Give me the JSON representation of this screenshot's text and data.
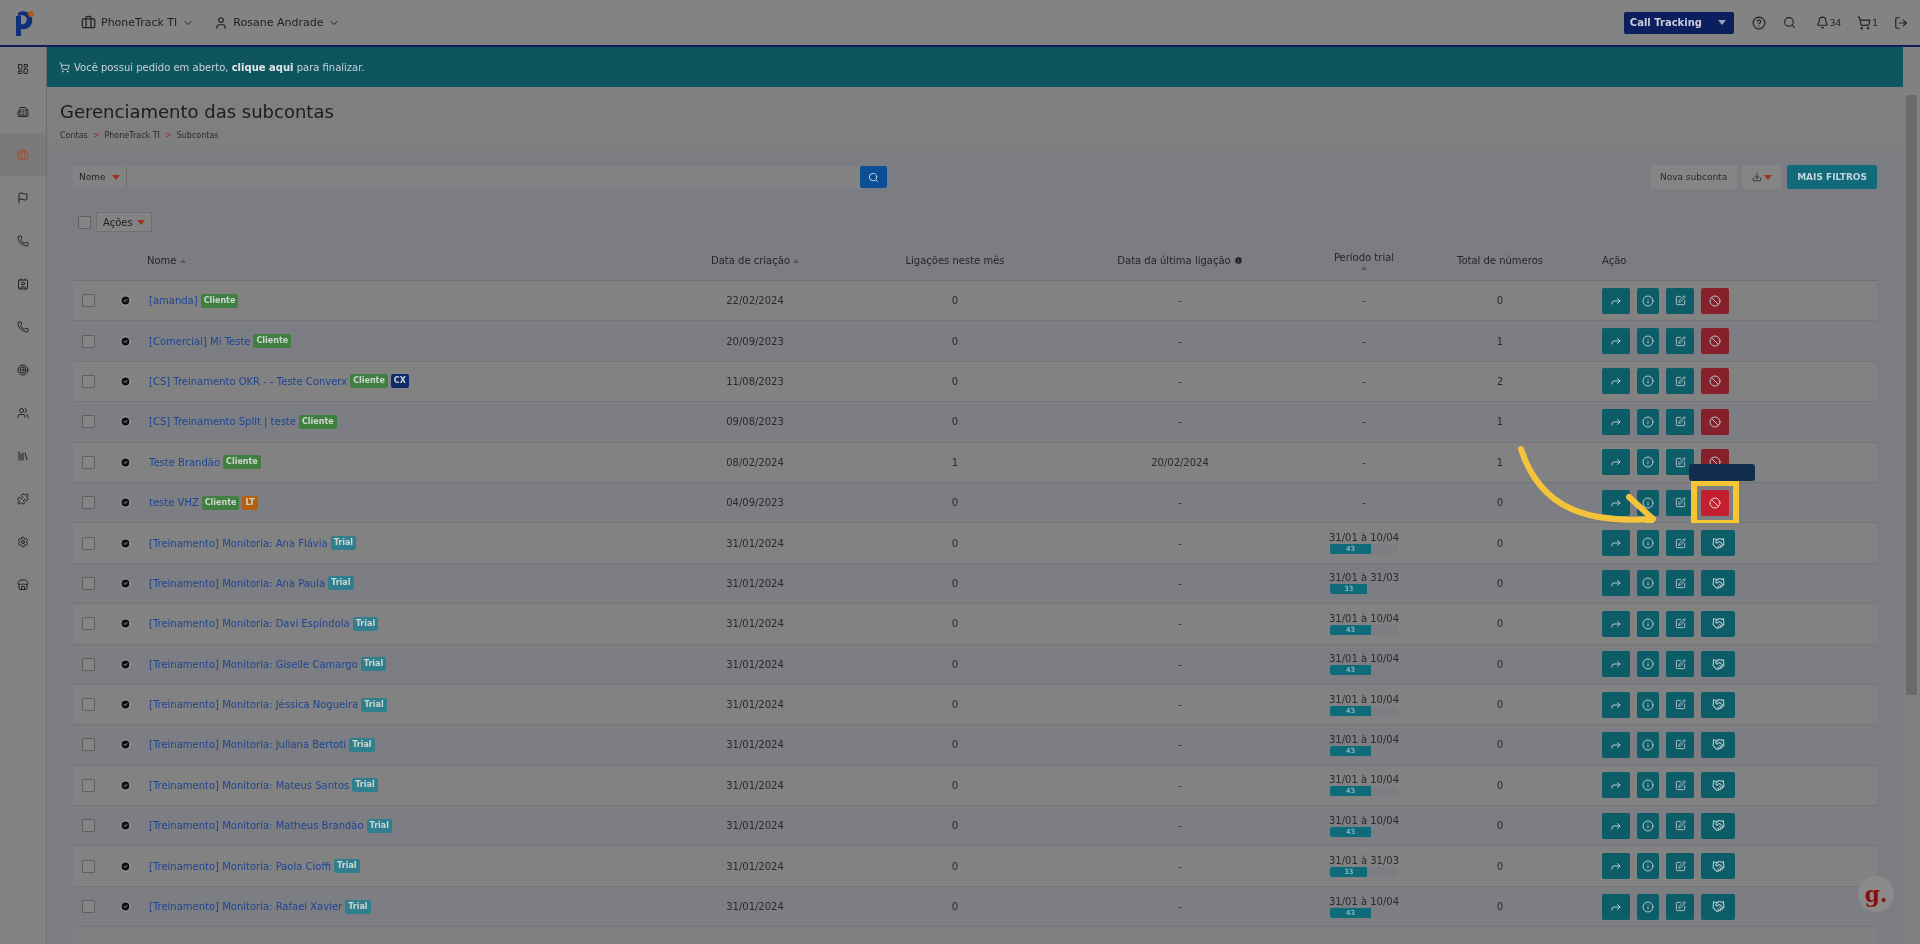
{
  "topbar": {
    "account": "PhoneTrack TI",
    "user": "Rosane Andrade",
    "product": "Call Tracking",
    "notifications": "34",
    "cart": "1"
  },
  "sidebar": {
    "items": [
      {
        "kind": "dashboard",
        "selected": false
      },
      {
        "kind": "building",
        "selected": false
      },
      {
        "kind": "briefcase",
        "selected": true
      },
      {
        "kind": "flag",
        "selected": false
      },
      {
        "kind": "phone",
        "selected": false
      },
      {
        "kind": "contact",
        "selected": false
      },
      {
        "kind": "phone",
        "selected": false
      },
      {
        "kind": "target",
        "selected": false
      },
      {
        "kind": "users",
        "selected": false
      },
      {
        "kind": "library",
        "selected": false
      },
      {
        "kind": "puzzle",
        "selected": false
      },
      {
        "kind": "settings",
        "selected": false
      },
      {
        "kind": "store",
        "selected": false
      }
    ]
  },
  "banner": {
    "before": "Você possui pedido em aberto,",
    "link": "clique aqui",
    "after": "para finalizar."
  },
  "page": {
    "title": "Gerenciamento das subcontas",
    "separator": ">",
    "breadcrumb": [
      "Contas",
      "PhoneTrack TI",
      "Subcontas"
    ]
  },
  "filter": {
    "field": "Nome",
    "buttons": [
      "Nova subconta",
      "MAIS FILTROS"
    ]
  },
  "toolbar": {
    "actions": "Ações",
    "select_all": false
  },
  "columns": [
    {
      "label": "Nome",
      "sortable": true,
      "info": false
    },
    {
      "label": "Data de criação",
      "sortable": true,
      "info": false
    },
    {
      "label": "Ligações neste mês",
      "sortable": false,
      "info": false
    },
    {
      "label": "Data da última ligação",
      "sortable": false,
      "info": true
    },
    {
      "label": "Período trial",
      "sortable": true,
      "info": false
    },
    {
      "label": "Total de números",
      "sortable": false,
      "info": false
    },
    {
      "label": "Ação",
      "sortable": false,
      "info": false
    }
  ],
  "rows": [
    {
      "name": "[amanda]",
      "tags": [
        {
          "label": "Cliente",
          "color": "#3f7f3f"
        }
      ],
      "created": "22/02/2024",
      "calls": "0",
      "last_call": "-",
      "trial": {
        "kind": "none",
        "text": "-"
      },
      "total": "0",
      "kind": "cancel",
      "checked": false,
      "highlighted": false
    },
    {
      "name": "[Comercial] Mi Teste",
      "tags": [
        {
          "label": "Cliente",
          "color": "#3f7f3f"
        }
      ],
      "created": "20/09/2023",
      "calls": "0",
      "last_call": "-",
      "trial": {
        "kind": "none",
        "text": "-"
      },
      "total": "1",
      "kind": "cancel",
      "checked": false,
      "highlighted": false
    },
    {
      "name": "[CS] Treinamento OKR - - Teste Converx",
      "tags": [
        {
          "label": "Cliente",
          "color": "#3f7f3f"
        },
        {
          "label": "CX",
          "color": "#102a6e"
        }
      ],
      "created": "11/08/2023",
      "calls": "0",
      "last_call": "-",
      "trial": {
        "kind": "none",
        "text": "-"
      },
      "total": "2",
      "kind": "cancel",
      "checked": false,
      "highlighted": false
    },
    {
      "name": "[CS] Treinamento Split | teste",
      "tags": [
        {
          "label": "Cliente",
          "color": "#3f7f3f"
        }
      ],
      "created": "09/08/2023",
      "calls": "0",
      "last_call": "-",
      "trial": {
        "kind": "none",
        "text": "-"
      },
      "total": "1",
      "kind": "cancel",
      "checked": false,
      "highlighted": false
    },
    {
      "name": "Teste Brandão",
      "tags": [
        {
          "label": "Cliente",
          "color": "#3f7f3f"
        }
      ],
      "created": "08/02/2024",
      "calls": "1",
      "last_call": "20/02/2024",
      "trial": {
        "kind": "none",
        "text": "-"
      },
      "total": "1",
      "kind": "cancel",
      "checked": false,
      "highlighted": false
    },
    {
      "name": "teste VHZ",
      "tags": [
        {
          "label": "Cliente",
          "color": "#3f7f3f"
        },
        {
          "label": "LT",
          "color": "#b5600f"
        }
      ],
      "created": "04/09/2023",
      "calls": "0",
      "last_call": "-",
      "trial": {
        "kind": "none",
        "text": "-"
      },
      "total": "0",
      "kind": "cancel",
      "checked": false,
      "highlighted": true
    },
    {
      "name": "[Treinamento] Monitoria: Ana Flávia",
      "tags": [
        {
          "label": "Trial",
          "color": "#2f7f8e"
        }
      ],
      "created": "31/01/2024",
      "calls": "0",
      "last_call": "-",
      "trial": {
        "kind": "bar",
        "text": "31/01 à 10/04",
        "days": "43",
        "level": 0.6
      },
      "total": "0",
      "kind": "trial",
      "checked": false,
      "highlighted": false
    },
    {
      "name": "[Treinamento] Monitoria: Ana Paula",
      "tags": [
        {
          "label": "Trial",
          "color": "#2f7f8e"
        }
      ],
      "created": "31/01/2024",
      "calls": "0",
      "last_call": "-",
      "trial": {
        "kind": "bar",
        "text": "31/01 à 31/03",
        "days": "33",
        "level": 0.55
      },
      "total": "0",
      "kind": "trial",
      "checked": false,
      "highlighted": false
    },
    {
      "name": "[Treinamento] Monitoria: Davi Espíndola",
      "tags": [
        {
          "label": "Trial",
          "color": "#2f7f8e"
        }
      ],
      "created": "31/01/2024",
      "calls": "0",
      "last_call": "-",
      "trial": {
        "kind": "bar",
        "text": "31/01 à 10/04",
        "days": "43",
        "level": 0.6
      },
      "total": "0",
      "kind": "trial",
      "checked": false,
      "highlighted": false
    },
    {
      "name": "[Treinamento] Monitoria: Giselle Camargo",
      "tags": [
        {
          "label": "Trial",
          "color": "#2f7f8e"
        }
      ],
      "created": "31/01/2024",
      "calls": "0",
      "last_call": "-",
      "trial": {
        "kind": "bar",
        "text": "31/01 à 10/04",
        "days": "43",
        "level": 0.6
      },
      "total": "0",
      "kind": "trial",
      "checked": false,
      "highlighted": false
    },
    {
      "name": "[Treinamento] Monitoria: Jéssica Nogueira",
      "tags": [
        {
          "label": "Trial",
          "color": "#2f7f8e"
        }
      ],
      "created": "31/01/2024",
      "calls": "0",
      "last_call": "-",
      "trial": {
        "kind": "bar",
        "text": "31/01 à 10/04",
        "days": "43",
        "level": 0.6
      },
      "total": "0",
      "kind": "trial",
      "checked": false,
      "highlighted": false
    },
    {
      "name": "[Treinamento] Monitoria: Juliana Bertoti",
      "tags": [
        {
          "label": "Trial",
          "color": "#2f7f8e"
        }
      ],
      "created": "31/01/2024",
      "calls": "0",
      "last_call": "-",
      "trial": {
        "kind": "bar",
        "text": "31/01 à 10/04",
        "days": "43",
        "level": 0.6
      },
      "total": "0",
      "kind": "trial",
      "checked": false,
      "highlighted": false
    },
    {
      "name": "[Treinamento] Monitoria: Mateus Santos",
      "tags": [
        {
          "label": "Trial",
          "color": "#2f7f8e"
        }
      ],
      "created": "31/01/2024",
      "calls": "0",
      "last_call": "-",
      "trial": {
        "kind": "bar",
        "text": "31/01 à 10/04",
        "days": "43",
        "level": 0.6
      },
      "total": "0",
      "kind": "trial",
      "checked": false,
      "highlighted": false
    },
    {
      "name": "[Treinamento] Monitoria: Matheus Brandão",
      "tags": [
        {
          "label": "Trial",
          "color": "#2f7f8e"
        }
      ],
      "created": "31/01/2024",
      "calls": "0",
      "last_call": "-",
      "trial": {
        "kind": "bar",
        "text": "31/01 à 10/04",
        "days": "43",
        "level": 0.6
      },
      "total": "0",
      "kind": "trial",
      "checked": false,
      "highlighted": false
    },
    {
      "name": "[Treinamento] Monitoria: Paola Cioffi",
      "tags": [
        {
          "label": "Trial",
          "color": "#2f7f8e"
        }
      ],
      "created": "31/01/2024",
      "calls": "0",
      "last_call": "-",
      "trial": {
        "kind": "bar",
        "text": "31/01 à 31/03",
        "days": "33",
        "level": 0.55
      },
      "total": "0",
      "kind": "trial",
      "checked": false,
      "highlighted": false
    },
    {
      "name": "[Treinamento] Monitoria: Rafael Xavier",
      "tags": [
        {
          "label": "Trial",
          "color": "#2f7f8e"
        }
      ],
      "created": "31/01/2024",
      "calls": "0",
      "last_call": "-",
      "trial": {
        "kind": "bar",
        "text": "31/01 à 10/04",
        "days": "43",
        "level": 0.6
      },
      "total": "0",
      "kind": "trial",
      "checked": false,
      "highlighted": false
    }
  ],
  "widget": {
    "label": "g."
  }
}
